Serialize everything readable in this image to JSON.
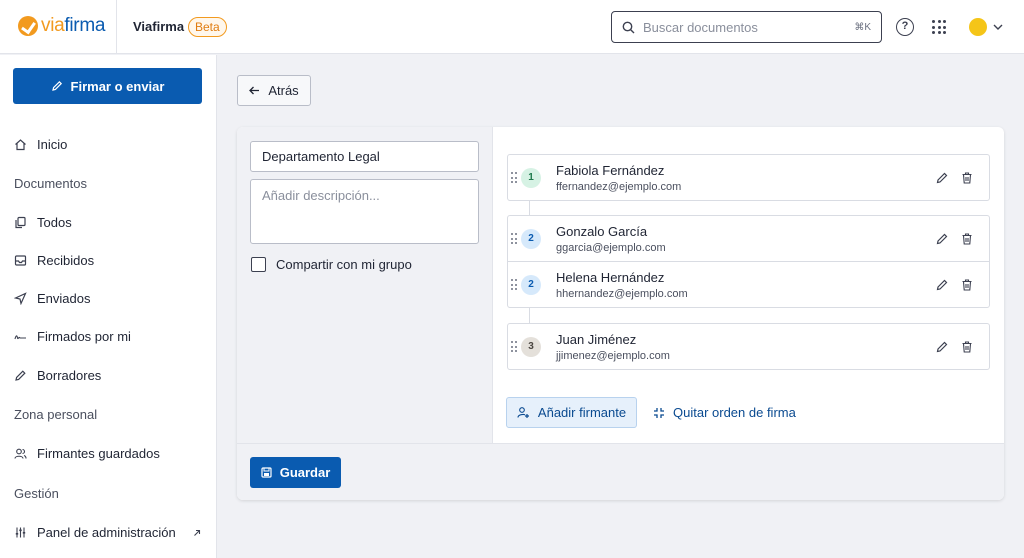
{
  "brand": {
    "logo_text_a": "via",
    "logo_text_b": "firma",
    "app_name": "Viafirma",
    "badge": "Beta",
    "accent": "#0a5bb0",
    "orange": "#f29a1f"
  },
  "search": {
    "placeholder": "Buscar documentos",
    "shortcut": "⌘K",
    "icon": "search-icon"
  },
  "header_icons": [
    "help-icon",
    "apps-grid-icon",
    "avatar",
    "chevron-down-icon"
  ],
  "help_glyph": "?",
  "sidebar": {
    "primary_button": "Firmar o enviar",
    "items": [
      {
        "label": "Inicio",
        "icon": "home-icon"
      },
      {
        "section": "Documentos"
      },
      {
        "label": "Todos",
        "icon": "copy-icon"
      },
      {
        "label": "Recibidos",
        "icon": "inbox-icon"
      },
      {
        "label": "Enviados",
        "icon": "send-icon"
      },
      {
        "label": "Firmados por mi",
        "icon": "signature-icon"
      },
      {
        "label": "Borradores",
        "icon": "pencil-icon"
      },
      {
        "section": "Zona personal"
      },
      {
        "label": "Firmantes guardados",
        "icon": "users-icon"
      },
      {
        "section": "Gestión"
      },
      {
        "label": "Panel de administración",
        "icon": "sliders-icon",
        "external": true
      }
    ]
  },
  "main": {
    "back_label": "Atrás",
    "group_name": "Departamento Legal",
    "description_placeholder": "Añadir descripción...",
    "share_label": "Compartir con mi grupo",
    "share_checked": false,
    "signers": [
      {
        "order": "1",
        "name": "Fabiola Fernández",
        "email": "ffernandez@ejemplo.com"
      },
      {
        "order": "2",
        "name": "Gonzalo García",
        "email": "ggarcia@ejemplo.com"
      },
      {
        "order": "2",
        "name": "Helena Hernández",
        "email": "hhernandez@ejemplo.com"
      },
      {
        "order": "3",
        "name": "Juan Jiménez",
        "email": "jjimenez@ejemplo.com"
      }
    ],
    "add_signer_label": "Añadir firmante",
    "remove_order_label": "Quitar orden de firma",
    "save_label": "Guardar"
  }
}
